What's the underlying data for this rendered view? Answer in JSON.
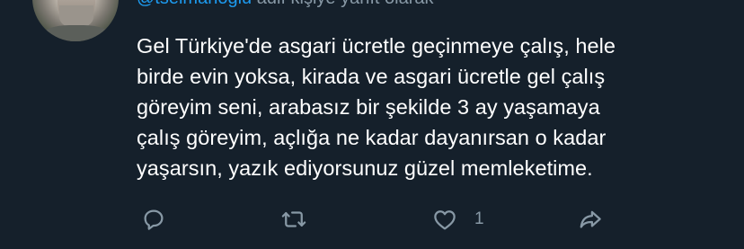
{
  "reply_context": {
    "handle": "@tselmanoglu",
    "suffix": " adlı kişiye yanıt olarak"
  },
  "tweet": {
    "lines": [
      "Gel Türkiye'de asgari ücretle geçinmeye çalış, hele",
      "birde evin yoksa, kirada ve asgari ücretle gel çalış",
      "göreyim seni, arabasız bir şekilde 3 ay yaşamaya",
      "çalış göreyim, açlığa ne kadar dayanırsan o kadar",
      "yaşarsın, yazık ediyorsunuz güzel memleketime."
    ]
  },
  "actions": {
    "reply_icon": "speech-bubble-icon",
    "retweet_icon": "retweet-arrows-icon",
    "like_icon": "heart-icon",
    "like_count": "1",
    "share_icon": "share-arrow-icon"
  },
  "colors": {
    "background": "#15202b",
    "text": "#ffffff",
    "muted": "#8899a6",
    "accent": "#1d9bf0"
  }
}
